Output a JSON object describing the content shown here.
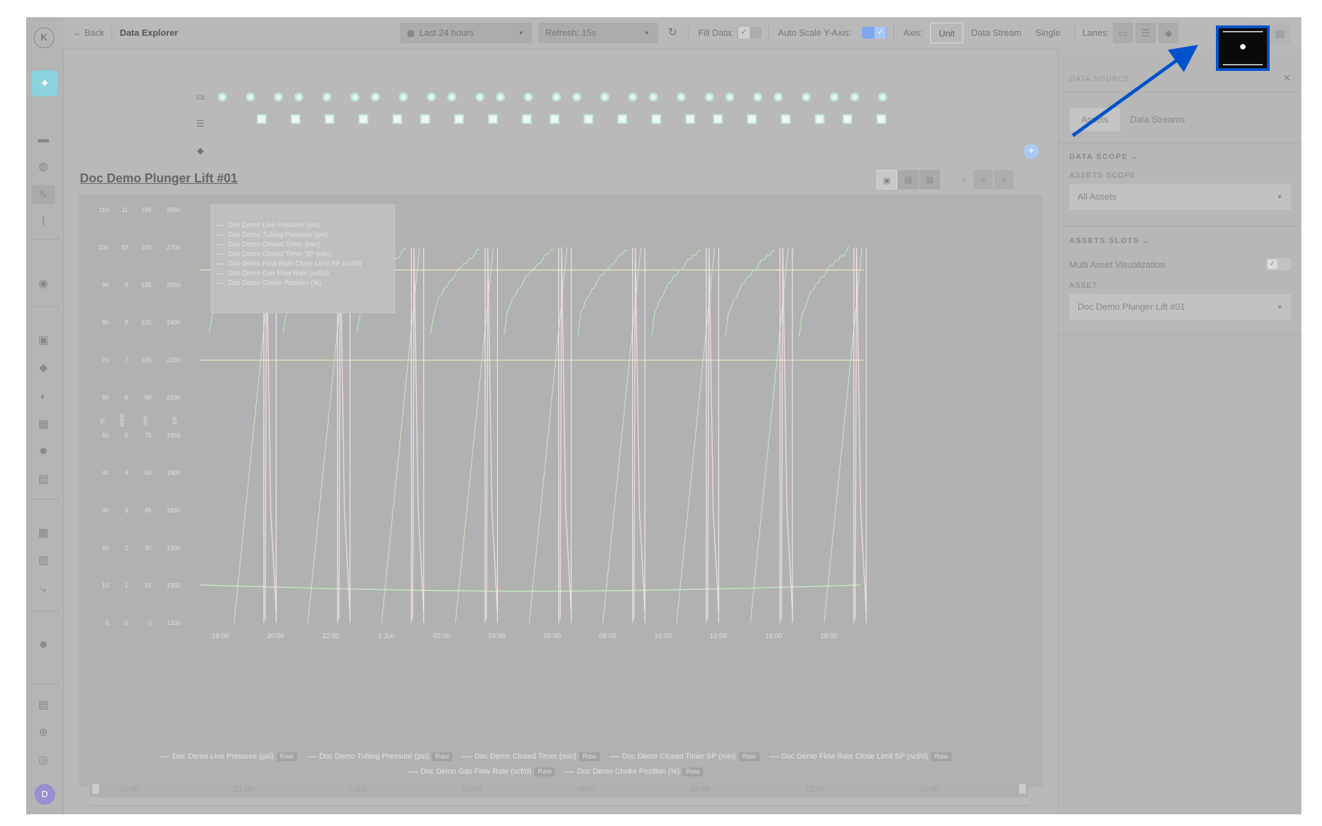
{
  "sidebar": {
    "logo": "K",
    "user_initial": "D"
  },
  "topbar": {
    "back_label": "Back",
    "page_title": "Data Explorer",
    "time_range": "Last 24 hours",
    "refresh": "Refresh: 15s",
    "fill_data_label": "Fill Data:",
    "auto_scale_label": "Auto Scale Y-Axis:",
    "axis_label": "Axis:",
    "axis_options": [
      "Unit",
      "Data Stream",
      "Single"
    ],
    "axis_selected": "Unit",
    "lanes_label": "Lanes:"
  },
  "chart": {
    "title": "Doc Demo Plunger Lift #01",
    "legend_header": "-",
    "legend_value": "-",
    "unit_labels": [
      "%",
      "scf/d",
      "min",
      "psi"
    ],
    "raw_label": "Raw"
  },
  "chart_data": {
    "type": "line",
    "title": "Doc Demo Plunger Lift #01",
    "x_ticks": [
      "18:00",
      "20:00",
      "22:00",
      "2 Jun",
      "02:00",
      "04:00",
      "06:00",
      "08:00",
      "10:00",
      "12:00",
      "14:00",
      "16:00"
    ],
    "y_axes": [
      {
        "unit": "%",
        "ticks": [
          0,
          10,
          20,
          30,
          40,
          50,
          60,
          70,
          80,
          90,
          100,
          110
        ]
      },
      {
        "unit": "scf/d",
        "ticks": [
          0,
          1,
          2,
          3,
          4,
          5,
          6,
          7,
          8,
          9,
          10,
          11
        ]
      },
      {
        "unit": "min",
        "ticks": [
          0,
          15,
          30,
          45,
          60,
          75,
          90,
          105,
          120,
          135,
          150,
          165
        ]
      },
      {
        "unit": "psi",
        "ticks": [
          1200,
          1350,
          1500,
          1650,
          1800,
          1950,
          2100,
          2250,
          2400,
          2550,
          2700,
          2850
        ]
      }
    ],
    "series": [
      {
        "name": "Doc Demo Line Pressure (psi)",
        "color": "#c7e6c4",
        "approx_range_psi": [
          1330,
          1355
        ]
      },
      {
        "name": "Doc Demo Tubing Pressure (psi)",
        "color": "#b8e8b8",
        "cycle_min_psi": 2350,
        "cycle_max_psi": 2700
      },
      {
        "name": "Doc Demo Closed Timer (min)",
        "color": "#d2e8c6",
        "max_min": 150
      },
      {
        "name": "Doc Demo Closed Timer SP (min)",
        "color": "#ecedc0",
        "value_min": 105
      },
      {
        "name": "Doc Demo Flow Rate Close Limit SP (scf/d)",
        "color": "#ecedc0",
        "value": 9.4
      },
      {
        "name": "Doc Demo Gas Flow Rate (scf/d)",
        "color": "#f2d8e1",
        "peak": 10
      },
      {
        "name": "Doc Demo Choke Position (%)",
        "color": "#ffffff",
        "values": [
          0,
          100
        ]
      }
    ],
    "cycle_count": 9,
    "event_markers_top": 27,
    "event_markers_mid": 20
  },
  "navigator": {
    "ticks": [
      "18:00",
      "21:00",
      "2 Jun",
      "03:00",
      "06:00",
      "09:00",
      "12:00",
      "15:00"
    ]
  },
  "rpanel": {
    "title": "DATA SOURCE",
    "tabs": [
      "Assets",
      "Data Streams"
    ],
    "active_tab": "Assets",
    "data_scope_label": "DATA SCOPE",
    "assets_scope_label": "ASSETS SCOPE",
    "assets_scope_value": "All Assets",
    "assets_slots_label": "ASSETS SLOTS",
    "multi_asset_label": "Multi Asset Visualization",
    "asset_label": "ASSET",
    "asset_value": "Doc Demo Plunger Lift #01"
  },
  "colors": {
    "accent": "#0052cc",
    "highlight_fill": "#0a0a0a",
    "spark_button": "#8ad2dd",
    "checkbox": "#7da8f0",
    "avatar": "#9a8dd1"
  }
}
